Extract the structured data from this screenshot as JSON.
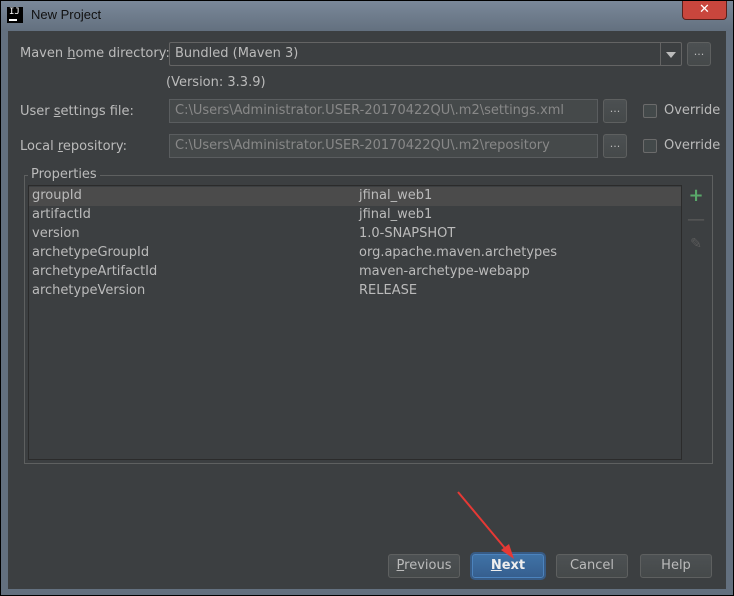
{
  "window": {
    "title": "New Project",
    "app_icon_text": "IJ",
    "close_glyph": "✕"
  },
  "maven_home": {
    "label_pre": "Maven ",
    "label_u": "h",
    "label_post": "ome directory:",
    "value": "Bundled (Maven 3)",
    "version": "(Version: 3.3.9)"
  },
  "user_settings": {
    "label_pre": "User ",
    "label_u": "s",
    "label_post": "ettings file:",
    "value": "C:\\Users\\Administrator.USER-20170422QU\\.m2\\settings.xml",
    "override_label": "Override",
    "browse_label": "..."
  },
  "local_repo": {
    "label_pre": "Local ",
    "label_u": "r",
    "label_post": "epository:",
    "value": "C:\\Users\\Administrator.USER-20170422QU\\.m2\\repository",
    "override_label": "Override",
    "browse_label": "..."
  },
  "maven_home_browse": "...",
  "properties": {
    "title": "Properties",
    "rows": [
      {
        "key": "groupId",
        "value": "jfinal_web1"
      },
      {
        "key": "artifactId",
        "value": "jfinal_web1"
      },
      {
        "key": "version",
        "value": "1.0-SNAPSHOT"
      },
      {
        "key": "archetypeGroupId",
        "value": "org.apache.maven.archetypes"
      },
      {
        "key": "archetypeArtifactId",
        "value": "maven-archetype-webapp"
      },
      {
        "key": "archetypeVersion",
        "value": "RELEASE"
      }
    ],
    "toolbar": {
      "add": "+",
      "remove": "—",
      "edit": "✎"
    }
  },
  "buttons": {
    "previous_u": "P",
    "previous_rest": "revious",
    "next_u": "N",
    "next_rest": "ext",
    "cancel": "Cancel",
    "help": "Help"
  },
  "colors": {
    "accent": "#365f8f",
    "annotation_arrow": "#e53935",
    "add_icon": "#59a869"
  }
}
